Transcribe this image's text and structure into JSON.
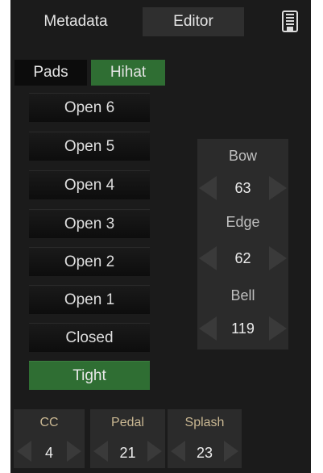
{
  "tabs": {
    "metadata": "Metadata",
    "editor": "Editor"
  },
  "subtabs": {
    "pads": "Pads",
    "hihat": "Hihat"
  },
  "hihat_buttons": [
    "Open 6",
    "Open 5",
    "Open 4",
    "Open 3",
    "Open 2",
    "Open 1",
    "Closed",
    "Tight"
  ],
  "active_button": "Tight",
  "params": {
    "bow": {
      "label": "Bow",
      "value": "63"
    },
    "edge": {
      "label": "Edge",
      "value": "62"
    },
    "bell": {
      "label": "Bell",
      "value": "119"
    }
  },
  "footer": {
    "cc": {
      "label": "CC",
      "value": "4"
    },
    "pedal": {
      "label": "Pedal",
      "value": "21"
    },
    "splash": {
      "label": "Splash",
      "value": "23"
    }
  },
  "colors": {
    "accent": "#2f6e33",
    "label_gold": "#c9b792",
    "bg": "#1b1b1b",
    "panel": "#2b2b2b"
  },
  "icons": {
    "save": "save-icon"
  }
}
